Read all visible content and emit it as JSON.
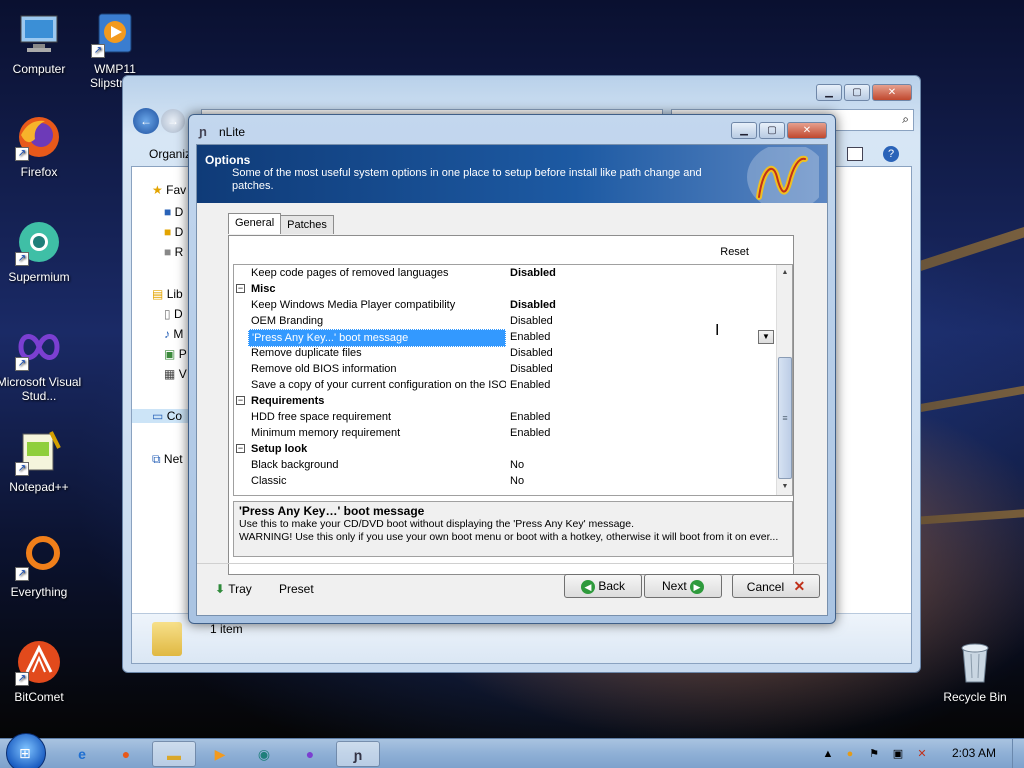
{
  "desktop_icons": [
    {
      "label": "Computer",
      "icon": "computer-icon"
    },
    {
      "label": "WMP11 Slipstre...",
      "icon": "wmp-icon"
    },
    {
      "label": "Firefox",
      "icon": "firefox-icon"
    },
    {
      "label": "Supermium",
      "icon": "supermium-icon"
    },
    {
      "label": "Microsoft Visual Stud...",
      "icon": "visual-studio-icon"
    },
    {
      "label": "Notepad++",
      "icon": "notepadpp-icon"
    },
    {
      "label": "Everything",
      "icon": "everything-icon"
    },
    {
      "label": "BitComet",
      "icon": "bitcomet-icon"
    },
    {
      "label": "Recycle Bin",
      "icon": "recycle-bin-icon"
    }
  ],
  "explorer": {
    "organize_label": "Organiz",
    "nav_items": [
      "Fav",
      "D",
      "D",
      "R",
      "Lib",
      "D",
      "M",
      "P",
      "V",
      "Co",
      "Net"
    ],
    "status": "1 item"
  },
  "nlite": {
    "window_title": "nLite",
    "header": {
      "title": "Options",
      "description": "Some of the most useful system options in one place to setup before install like path change and patches."
    },
    "tabs": [
      {
        "label": "General",
        "active": true
      },
      {
        "label": "Patches",
        "active": false
      }
    ],
    "reset_label": "Reset",
    "rows": [
      {
        "type": "item",
        "name": "Keep code pages of removed languages",
        "value": "Disabled",
        "bold": true
      },
      {
        "type": "category",
        "name": "Misc"
      },
      {
        "type": "item",
        "name": "Keep Windows Media Player compatibility",
        "value": "Disabled",
        "bold": true
      },
      {
        "type": "item",
        "name": "OEM Branding",
        "value": "Disabled",
        "bold": false
      },
      {
        "type": "item",
        "name": "'Press Any Key...' boot message",
        "value": "Enabled",
        "bold": false,
        "selected": true
      },
      {
        "type": "item",
        "name": "Remove duplicate files",
        "value": "Disabled",
        "bold": false
      },
      {
        "type": "item",
        "name": "Remove old BIOS information",
        "value": "Disabled",
        "bold": false
      },
      {
        "type": "item",
        "name": "Save a copy of your current configuration on the ISO",
        "value": "Enabled",
        "bold": false
      },
      {
        "type": "category",
        "name": "Requirements"
      },
      {
        "type": "item",
        "name": "HDD free space requirement",
        "value": "Enabled",
        "bold": false
      },
      {
        "type": "item",
        "name": "Minimum memory requirement",
        "value": "Enabled",
        "bold": false
      },
      {
        "type": "category",
        "name": "Setup look"
      },
      {
        "type": "item",
        "name": "Black background",
        "value": "No",
        "bold": false
      },
      {
        "type": "item",
        "name": "Classic",
        "value": "No",
        "bold": false
      }
    ],
    "description": {
      "title": "'Press Any Key…' boot message",
      "line1": "Use this to make your CD/DVD boot without displaying the 'Press Any Key' message.",
      "line2": "WARNING! Use this only if you use your own boot menu or boot with a hotkey, otherwise it will boot from it on ever..."
    },
    "footer": {
      "tray_label": "Tray",
      "preset_label": "Preset",
      "back_label": "Back",
      "next_label": "Next",
      "cancel_label": "Cancel"
    }
  },
  "taskbar": {
    "clock": "2:03 AM"
  },
  "colors": {
    "header_blue": "#1d5aa3",
    "selection_blue": "#3399ff",
    "taskbar": "#8fb0d6"
  }
}
